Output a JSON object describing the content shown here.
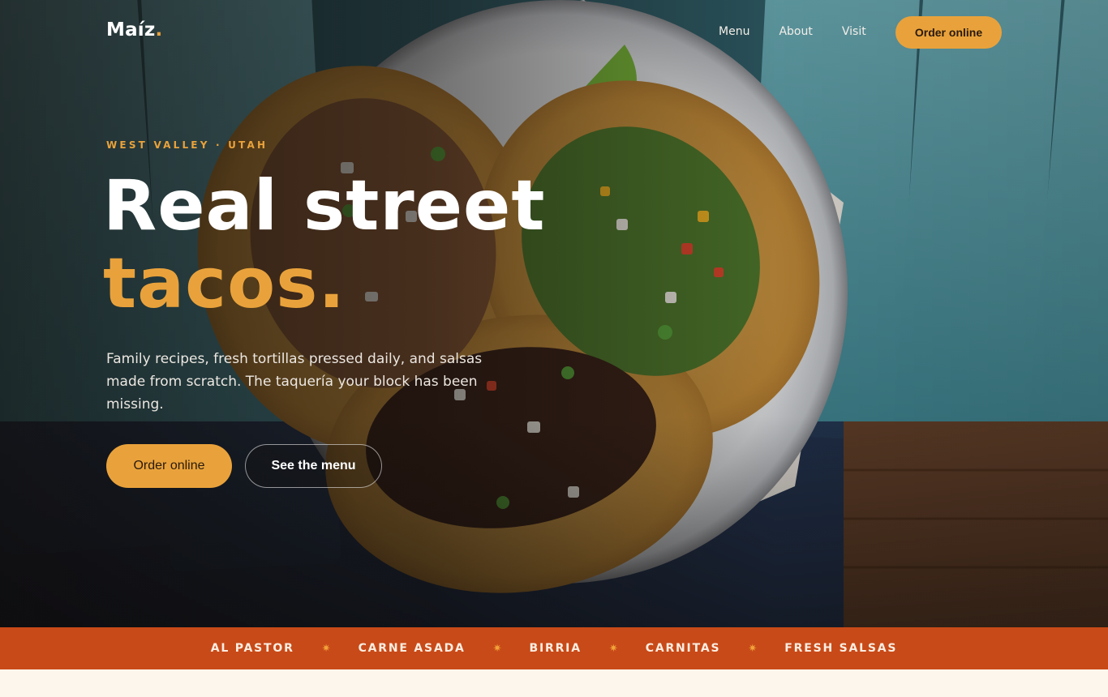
{
  "brand": {
    "name": "Maíz",
    "dot": "."
  },
  "nav": {
    "links": [
      {
        "label": "Menu"
      },
      {
        "label": "About"
      },
      {
        "label": "Visit"
      }
    ],
    "cta_label": "Order online"
  },
  "hero": {
    "eyebrow": "WEST VALLEY · UTAH",
    "headline_line1": "Real street",
    "headline_line2": "tacos.",
    "lede": "Family recipes, fresh tortillas pressed daily, and salsas made from scratch. The taquería your block has been missing.",
    "primary_cta": "Order online",
    "secondary_cta": "See the menu",
    "image": "tacos-plate-photo"
  },
  "ticker": {
    "items": [
      "AL PASTOR",
      "CARNE ASADA",
      "BIRRIA",
      "CARNITAS",
      "FRESH SALSAS"
    ],
    "separator": "✷"
  },
  "colors": {
    "accent": "#e9a23b",
    "ticker_bg": "#c84a18",
    "page_bg": "#fdf6ec"
  }
}
